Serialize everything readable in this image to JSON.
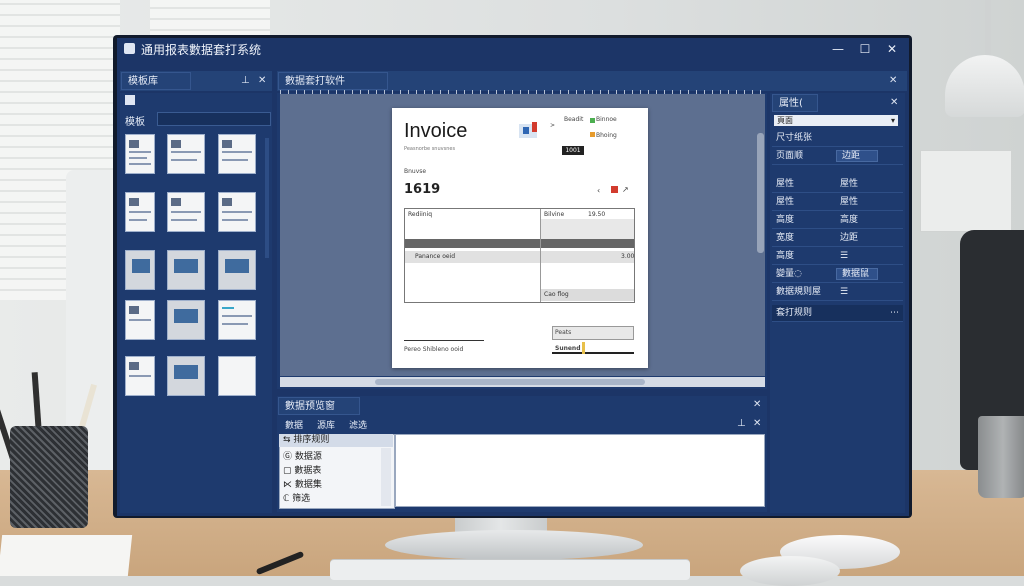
{
  "window": {
    "title": "通用报表數据套打系统",
    "min": "—",
    "max": "☐",
    "close": "✕"
  },
  "left_panel": {
    "tab": "模板库",
    "search_label": "模板",
    "pin": "⊥",
    "close": "✕"
  },
  "doc_panel": {
    "tab": "數据套打软件",
    "close": "✕"
  },
  "invoice": {
    "title": "Invoice",
    "subtitle": "Peasnorbe snuvsnes",
    "number": "1619",
    "number_label": "Bnuvse",
    "meta": [
      "Beadit",
      "Binnoe",
      "Bhoing"
    ],
    "table": {
      "r1_left": "Rediiniq",
      "r1_mid": "Bilvine",
      "r1_right": "19.50",
      "r4_left": "Panance oeid",
      "r4_right": "3.00",
      "footer_right": "Cao flog"
    },
    "sign_label": "Pereo Shibleno ooid",
    "total_label": "Peats",
    "due_label": "Sunend"
  },
  "bottom_panel": {
    "tab": "數据预览窗",
    "toolbar": [
      "數据",
      "源库",
      "滤选"
    ],
    "list_header": "⇆ 排序规则",
    "list_items": [
      "Ⓖ 数据源",
      "▢ 數据表",
      "⋉ 數据集",
      "ℂ 筛选"
    ],
    "close": "✕"
  },
  "right_panel": {
    "tab": "属性(",
    "close": "✕",
    "select_value": "頁面",
    "rows": [
      {
        "label": "尺寸纸张",
        "value": ""
      },
      {
        "label": "页面顺",
        "value": "边距"
      },
      {
        "label": "屋性",
        "value": "屋性"
      },
      {
        "label": "屋性",
        "value": "屋性"
      },
      {
        "label": "高度",
        "value": "高度"
      },
      {
        "label": "宽度",
        "value": "边距"
      },
      {
        "label": "高度",
        "value": "☰"
      },
      {
        "label": "變量◌",
        "value": "數据鼠"
      },
      {
        "label": "數据規则屋",
        "value": "☰"
      },
      {
        "label": "套打规则",
        "value": ""
      }
    ]
  }
}
